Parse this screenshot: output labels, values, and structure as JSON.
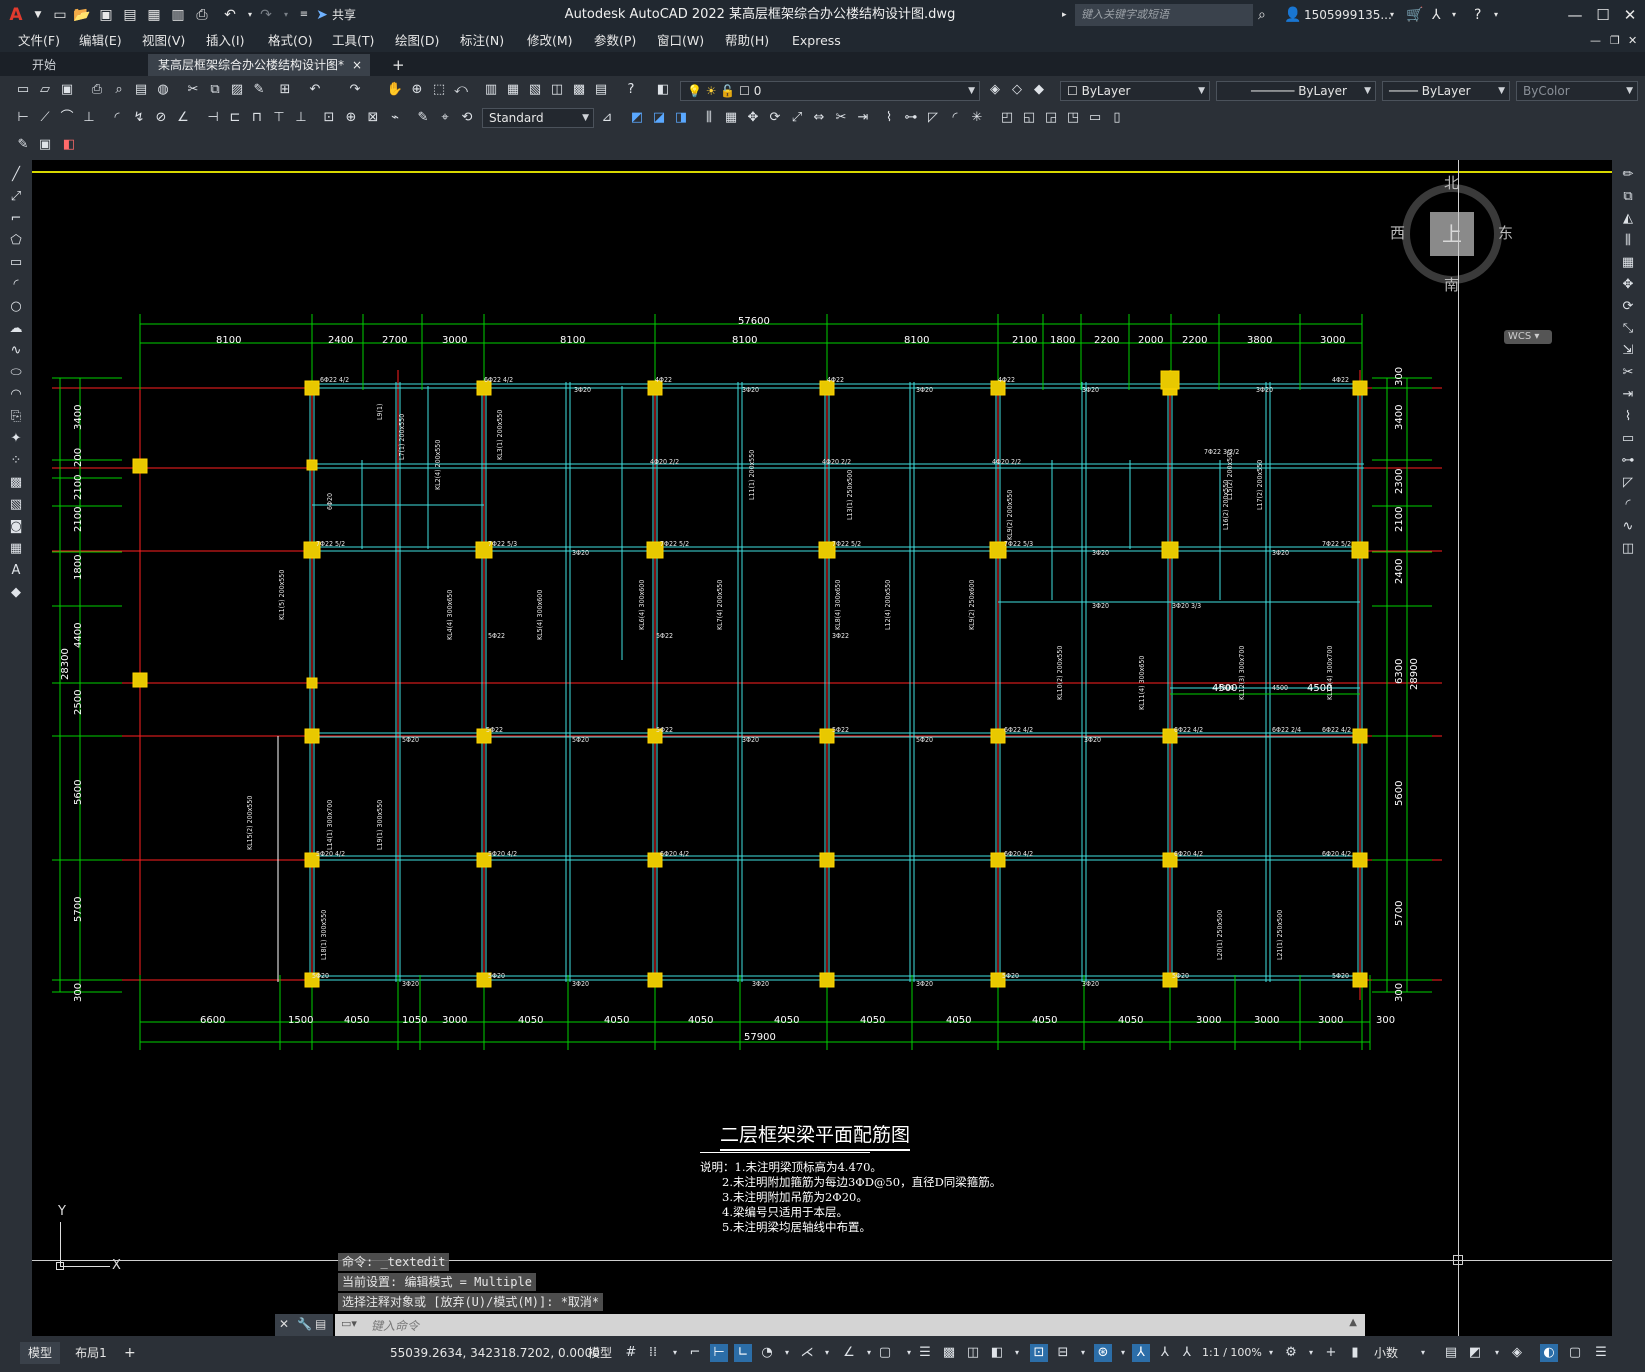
{
  "titlebar": {
    "app_letter": "A",
    "title": "Autodesk AutoCAD 2022    某高层框架综合办公楼结构设计图.dwg",
    "share_label": "共享",
    "search_placeholder": "键入关键字或短语",
    "user": "1505999135...",
    "quick_access_icons": [
      "new-icon",
      "open-icon",
      "save-icon",
      "saveas-icon",
      "publish-icon",
      "plot-icon",
      "undo-icon",
      "redo-icon",
      "share-icon"
    ]
  },
  "menubar": {
    "items": [
      "文件(F)",
      "编辑(E)",
      "视图(V)",
      "插入(I)",
      "格式(O)",
      "工具(T)",
      "绘图(D)",
      "标注(N)",
      "修改(M)",
      "参数(P)",
      "窗口(W)",
      "帮助(H)",
      "Express"
    ]
  },
  "filetabs": {
    "start": "开始",
    "active": "某高层框架综合办公楼结构设计图*",
    "close": "×",
    "add": "+"
  },
  "toolbar": {
    "layer_name": "0",
    "text_style": "Standard",
    "color": "ByLayer",
    "linetype": "ByLayer",
    "lineweight": "ByLayer",
    "plot_style": "ByColor"
  },
  "viewcube": {
    "north": "北",
    "south": "南",
    "east": "东",
    "west": "西",
    "face": "上",
    "wcs": "WCS"
  },
  "drawing": {
    "title": "二层框架梁平面配筋图",
    "notes": [
      "说明：1.未注明梁顶标高为4.470。",
      "2.未注明附加箍筋为每边3ΦD@50，直径D同梁箍筋。",
      "3.未注明附加吊筋为2Φ20。",
      "4.梁编号只适用于本层。",
      "5.未注明梁均居轴线中布置。"
    ],
    "top_total": "57600",
    "top_dims": [
      "8100",
      "2400",
      "2700",
      "3000",
      "8100",
      "8100",
      "8100",
      "2100",
      "1800",
      "2200",
      "2000",
      "2200",
      "3800",
      "3000"
    ],
    "bottom_total": "57900",
    "bottom_dims": [
      "6600",
      "1500",
      "4050",
      "1050",
      "3000",
      "4050",
      "4050",
      "4050",
      "4050",
      "4050",
      "4050",
      "4050",
      "4050",
      "3000",
      "3000",
      "3000",
      "300"
    ],
    "left_total": "28300",
    "left_dims": [
      "3400",
      "200",
      "2100",
      "2100",
      "1800",
      "4400",
      "2500",
      "5600",
      "5700",
      "300"
    ],
    "right_total": "28900",
    "right_dims": [
      "300",
      "3400",
      "2300",
      "2100",
      "2400",
      "6300",
      "5600",
      "5700",
      "300"
    ],
    "inner_dims": [
      "4500",
      "4500"
    ],
    "ucs_x": "X",
    "ucs_y": "Y"
  },
  "command": {
    "history": [
      "命令: _textedit",
      "当前设置: 编辑模式 = Multiple",
      "选择注释对象或 [放弃(U)/模式(M)]: *取消*"
    ],
    "placeholder": "键入命令"
  },
  "statusbar": {
    "tabs": [
      "模型",
      "布局1"
    ],
    "add": "+",
    "coords": "55039.2634, 342318.7202, 0.0000",
    "space": "模型",
    "scale": "1:1 / 100%",
    "units": "小数"
  },
  "colors": {
    "canvas": "#000000",
    "dim_green": "#00d000",
    "axis_red": "#ff2020",
    "beam_cyan": "#40e0e0",
    "column_yellow": "#e8c800",
    "chrome": "#2b3037"
  }
}
